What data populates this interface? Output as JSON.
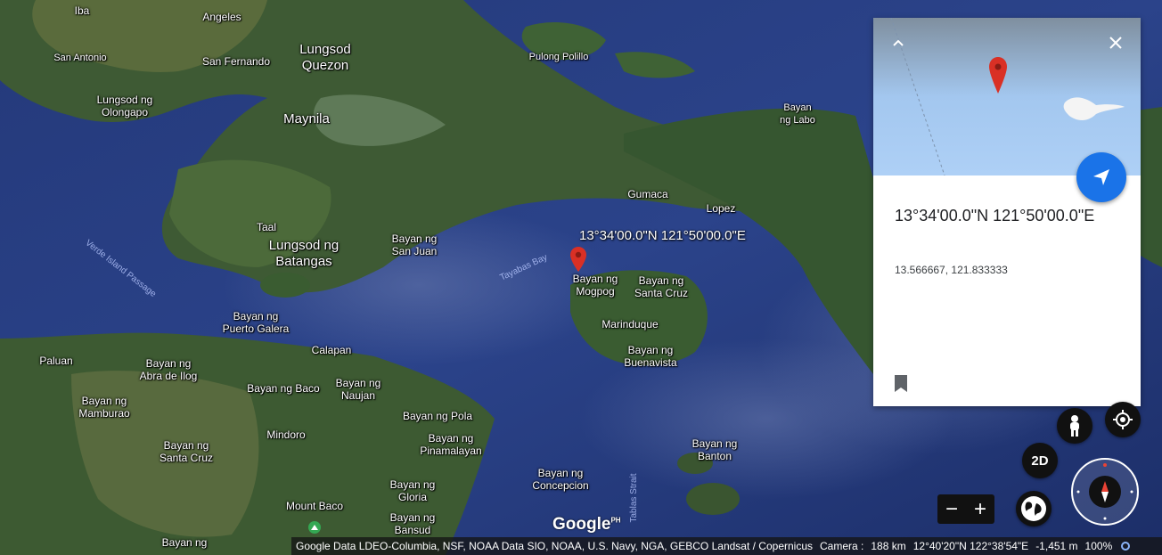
{
  "map": {
    "places": [
      {
        "id": "iba",
        "label": "Iba"
      },
      {
        "id": "angeles",
        "label": "Angeles"
      },
      {
        "id": "san-antonio",
        "label": "San Antonio"
      },
      {
        "id": "san-fernando",
        "label": "San Fernando"
      },
      {
        "id": "lungsod-quezon",
        "label": "Lungsod\nQuezon"
      },
      {
        "id": "lungsod-olongapo",
        "label": "Lungsod ng\nOlongapo"
      },
      {
        "id": "maynila",
        "label": "Maynila"
      },
      {
        "id": "pulong-polillo",
        "label": "Pulong Polillo"
      },
      {
        "id": "bayan-ng-labo",
        "label": "Bayan\nng Labo"
      },
      {
        "id": "gumaca",
        "label": "Gumaca"
      },
      {
        "id": "lopez",
        "label": "Lopez"
      },
      {
        "id": "taal",
        "label": "Taal"
      },
      {
        "id": "lungsod-batangas",
        "label": "Lungsod ng\nBatangas"
      },
      {
        "id": "bayan-san-juan",
        "label": "Bayan ng\nSan Juan"
      },
      {
        "id": "bayan-mogpog",
        "label": "Bayan ng\nMogpog"
      },
      {
        "id": "bayan-santa-cruz-marinduque",
        "label": "Bayan ng\nSanta Cruz"
      },
      {
        "id": "marinduque",
        "label": "Marinduque"
      },
      {
        "id": "bayan-buenavista",
        "label": "Bayan ng\nBuenavista"
      },
      {
        "id": "bayan-puerto-galera",
        "label": "Bayan ng\nPuerto Galera"
      },
      {
        "id": "calapan",
        "label": "Calapan"
      },
      {
        "id": "paluan",
        "label": "Paluan"
      },
      {
        "id": "bayan-abra-de-ilog",
        "label": "Bayan ng\nAbra de Ilog"
      },
      {
        "id": "bayan-baco",
        "label": "Bayan ng Baco"
      },
      {
        "id": "bayan-naujan",
        "label": "Bayan ng\nNaujan"
      },
      {
        "id": "bayan-mamburao",
        "label": "Bayan ng\nMamburao"
      },
      {
        "id": "bayan-pola",
        "label": "Bayan ng Pola"
      },
      {
        "id": "mindoro",
        "label": "Mindoro"
      },
      {
        "id": "bayan-pinamalayan",
        "label": "Bayan ng\nPinamalayan"
      },
      {
        "id": "bayan-santa-cruz-mindoro",
        "label": "Bayan ng\nSanta Cruz"
      },
      {
        "id": "bayan-banton",
        "label": "Bayan ng\nBanton"
      },
      {
        "id": "bayan-concepcion",
        "label": "Bayan ng\nConcepcion"
      },
      {
        "id": "bayan-gloria",
        "label": "Bayan ng\nGloria"
      },
      {
        "id": "mount-baco",
        "label": "Mount Baco"
      },
      {
        "id": "bayan-bansud",
        "label": "Bayan ng\nBansud"
      },
      {
        "id": "bayan-bottom",
        "label": "Bayan ng"
      }
    ],
    "water_labels": [
      {
        "id": "verde-island-passage",
        "label": "Verde Island Passage"
      },
      {
        "id": "tayabas-bay",
        "label": "Tayabas Bay"
      },
      {
        "id": "tablas-strait",
        "label": "Tablas Strait"
      }
    ],
    "pin_label": "13°34'00.0\"N 121°50'00.0\"E",
    "logo": "Google",
    "logo_suffix": "PH",
    "pin_color": "#d93025"
  },
  "info_card": {
    "title": "13°34'00.0\"N 121°50'00.0\"E",
    "decimal_coords": "13.566667, 121.833333",
    "accent": "#1a73e8"
  },
  "controls": {
    "toggle_2d_label": "2D",
    "zoom_out_label": "−",
    "zoom_in_label": "+"
  },
  "status_bar": {
    "attribution": "Google Data LDEO-Columbia, NSF, NOAA Data SIO, NOAA, U.S. Navy, NGA, GEBCO Landsat / Copernicus",
    "camera_label": "Camera :",
    "camera_distance": "188 km",
    "camera_coords": "12°40'20\"N 122°38'54\"E",
    "elevation": "-1,451 m",
    "zoom_percent": "100%"
  }
}
